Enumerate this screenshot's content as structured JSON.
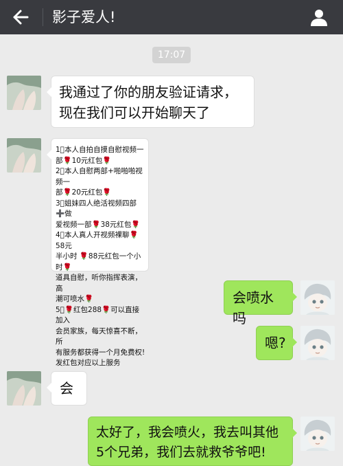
{
  "header": {
    "title": "影子爱人!",
    "back_icon": "arrow-left-icon",
    "user_icon": "user-profile-icon",
    "background": "#393a3f"
  },
  "timestamp": "17:07",
  "colors": {
    "chat_background": "#ebebeb",
    "incoming_bubble": "#ffffff",
    "outgoing_bubble": "#9fe65c"
  },
  "messages": [
    {
      "from": "contact",
      "text": "我通过了你的朋友验证请求，\n现在我们可以开始聊天了"
    },
    {
      "from": "contact",
      "text": "1⃣本人自拍自摸自慰视频一\n部🌹10元红包🌹\n2⃣本人自慰两部+啪啪啪视频一\n部🌹20元红包🌹\n3⃣姐妹四人绝活视频四部➕做\n爱视频一部🌹38元红包🌹\n4⃣本人真人开视频裸聊🌹58元\n半小时 🌹88元红包一个小时🌹\n道具自慰，听你指挥表演，高\n潮可喷水🌹\n5⃣🌹红包288🌹可以直接加入\n会员家族，每天惊喜不断，所\n有服务都获得一个月免费权!\n  发红包对应以上服务"
    },
    {
      "from": "me",
      "text": "会喷水吗"
    },
    {
      "from": "me",
      "text": "嗯?"
    },
    {
      "from": "contact",
      "text": "会"
    },
    {
      "from": "me",
      "text": "太好了，我会喷火，我去叫其他\n5个兄弟，我们去就救爷爷吧!"
    }
  ]
}
